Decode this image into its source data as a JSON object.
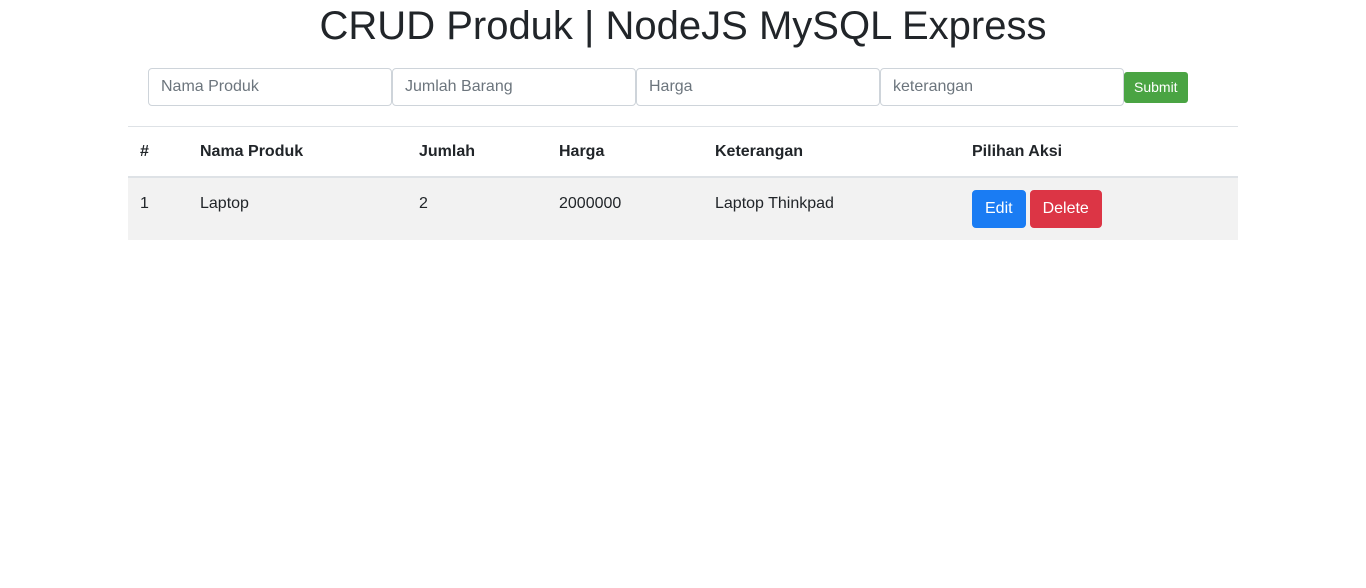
{
  "header": {
    "title": "CRUD Produk | NodeJS MySQL Express"
  },
  "form": {
    "nama_produk_placeholder": "Nama Produk",
    "jumlah_placeholder": "Jumlah Barang",
    "harga_placeholder": "Harga",
    "keterangan_placeholder": "keterangan",
    "submit_label": "Submit"
  },
  "table": {
    "headers": [
      "#",
      "Nama Produk",
      "Jumlah",
      "Harga",
      "Keterangan",
      "Pilihan Aksi"
    ],
    "rows": [
      {
        "no": "1",
        "nama": "Laptop",
        "jumlah": "2",
        "harga": "2000000",
        "keterangan": "Laptop Thinkpad",
        "edit_label": "Edit",
        "delete_label": "Delete"
      }
    ]
  },
  "colors": {
    "submit": "#4aa443",
    "edit": "#1a7cf3",
    "delete": "#dc3545",
    "row_stripe": "#f2f2f2"
  }
}
